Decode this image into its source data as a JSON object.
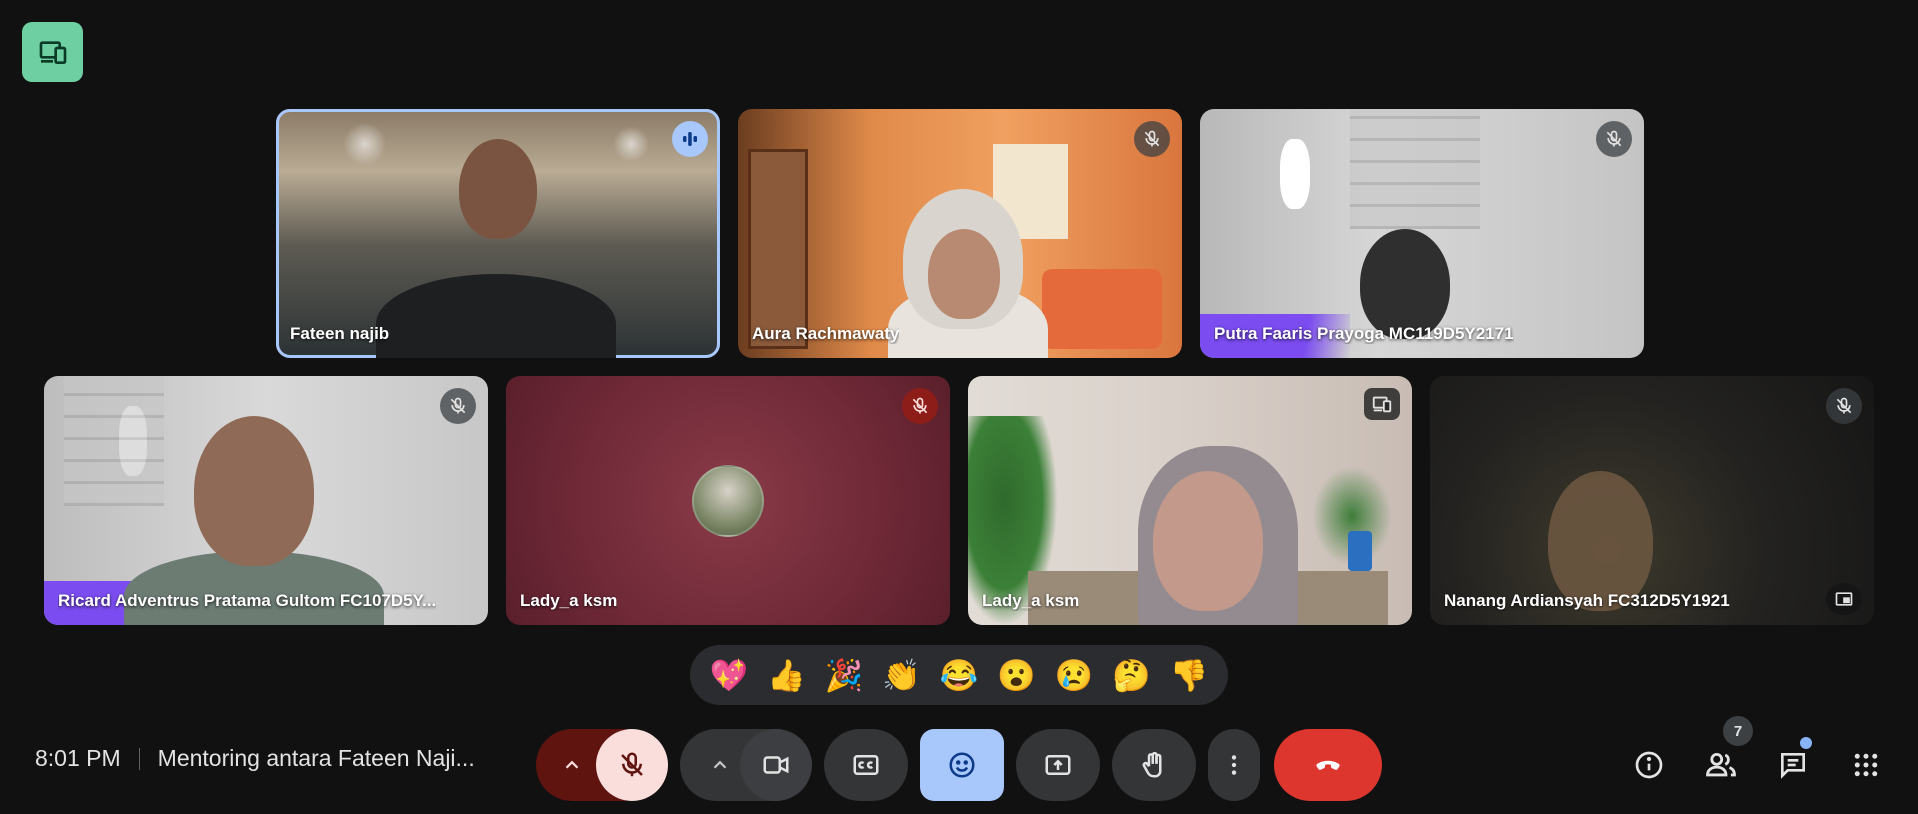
{
  "participants": [
    {
      "name": "Fateen najib",
      "status": "speaking"
    },
    {
      "name": "Aura Rachmawaty",
      "status": "muted"
    },
    {
      "name": "Putra Faaris Prayoga MC119D5Y2171",
      "status": "muted"
    },
    {
      "name": "Ricard Adventrus Pratama Gultom FC107D5Y...",
      "status": "muted"
    },
    {
      "name": "Lady_a ksm",
      "status": "muted"
    },
    {
      "name": "Lady_a ksm",
      "status": "presenting"
    },
    {
      "name": "Nanang Ardiansyah FC312D5Y1921",
      "status": "muted"
    }
  ],
  "reactions": [
    "💖",
    "👍",
    "🎉",
    "👏",
    "😂",
    "😮",
    "😢",
    "🤔",
    "👎"
  ],
  "meeting": {
    "time": "8:01 PM",
    "title": "Mentoring antara Fateen Naji..."
  },
  "people_count": "7",
  "colors": {
    "background": "#111111",
    "active_outline": "#a8c7fa",
    "end_call": "#dc362e",
    "mic_off_bg": "#f9dedc",
    "reaction_active": "#a8c7fa",
    "companion": "#6ed0a2"
  },
  "icons": {
    "companion": "devices-icon",
    "speaking": "audio-bars-icon",
    "muted": "mic-off-icon",
    "presenting": "devices-icon",
    "pin": "picture-in-picture-icon",
    "controls": [
      "chevron-up-icon",
      "mic-off-icon",
      "chevron-up-icon",
      "videocam-icon",
      "closed-caption-icon",
      "emoji-icon",
      "present-screen-icon",
      "raise-hand-icon",
      "more-vert-icon",
      "call-end-icon"
    ],
    "right": [
      "info-icon",
      "people-icon",
      "chat-icon",
      "apps-grid-icon"
    ]
  }
}
